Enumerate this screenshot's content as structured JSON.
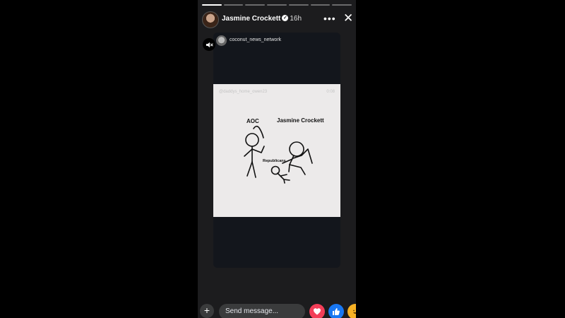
{
  "story": {
    "progress_total": 7,
    "progress_active_index": 0,
    "author_name": "Jasmine Crockett",
    "verified_glyph": "✓",
    "time_ago": "16h",
    "more_glyph": "•••",
    "close_glyph": "✕",
    "shared_post": {
      "account_handle": "coconut_news_network",
      "video": {
        "watermark": "@daddys_home_owen23",
        "timestamp": "0:08",
        "labels": {
          "left_figure": "AOC",
          "right_figure": "Jasmine Crockett",
          "ground_figure": "Republicans"
        }
      }
    }
  },
  "footer": {
    "add_glyph": "+",
    "message_placeholder": "Send message...",
    "reactions": [
      "love",
      "like",
      "haha"
    ]
  },
  "icons": [
    "verified-badge-icon",
    "more-icon",
    "close-icon",
    "mute-icon",
    "add-icon",
    "heart-icon",
    "thumbs-up-icon",
    "haha-icon"
  ],
  "colors": {
    "love": "#f33e58",
    "like": "#1877f2",
    "haha": "#f7b125",
    "background": "#000000",
    "story_panel": "#1c1c1e"
  }
}
